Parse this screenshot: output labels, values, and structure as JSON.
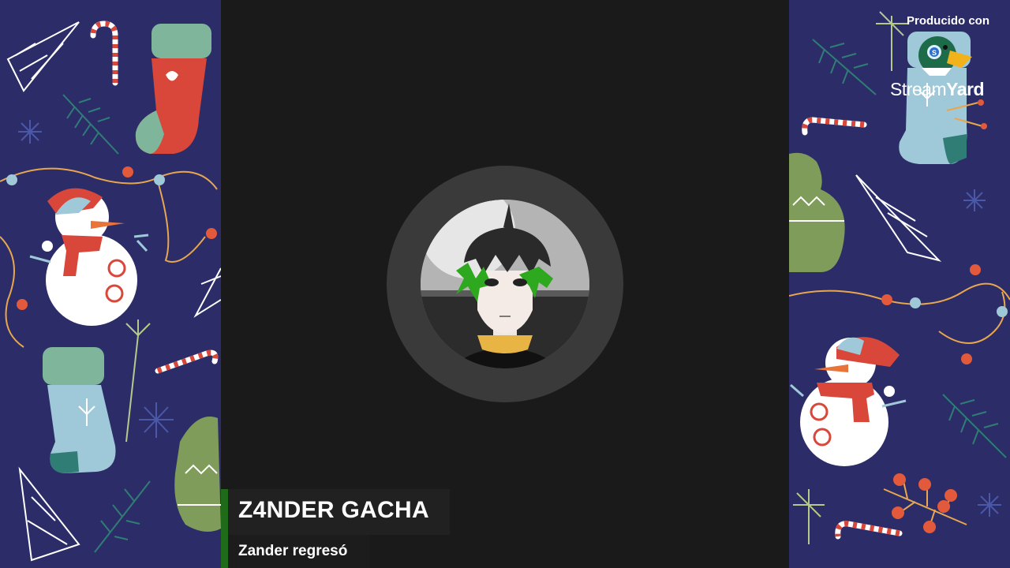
{
  "lower_third": {
    "name": "Z4NDER GACHA",
    "subtitle": "Zander regresó"
  },
  "watermark": {
    "label": "Producido con",
    "brand_light": "Stream",
    "brand_bold": "Yard",
    "logo_icon": "duck-logo-icon"
  },
  "colors": {
    "side_background": "#2c2d68",
    "stage_background": "#1a1a1a",
    "ring": "#3a3a3a",
    "accent_green": "#1f6b1a",
    "name_bar": "#212121"
  },
  "decor": {
    "left_panel_icons": [
      "christmas-tree-icon",
      "candy-cane-icon",
      "stocking-icon",
      "snowman-icon",
      "string-lights-icon",
      "snowflake-icon",
      "mitten-icon",
      "pine-branch-icon"
    ],
    "right_panel_icons": [
      "pine-branch-icon",
      "stocking-icon",
      "candy-cane-icon",
      "mitten-icon",
      "christmas-tree-icon",
      "string-lights-icon",
      "snowman-icon",
      "berries-icon",
      "snowflake-icon"
    ]
  }
}
